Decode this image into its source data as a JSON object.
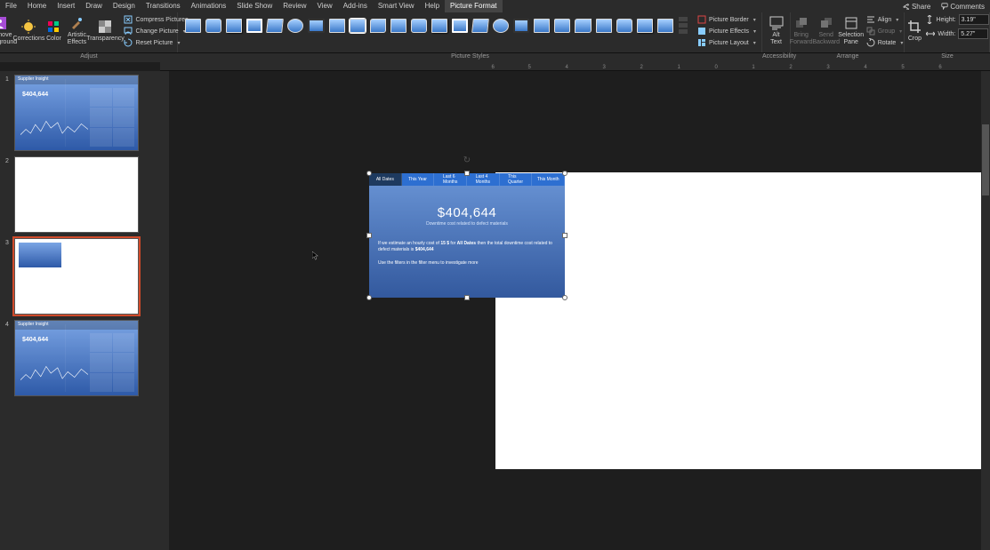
{
  "menu": {
    "tabs": [
      "File",
      "Home",
      "Insert",
      "Draw",
      "Design",
      "Transitions",
      "Animations",
      "Slide Show",
      "Review",
      "View",
      "Add-ins",
      "Smart View",
      "Help",
      "Picture Format"
    ],
    "active_index": 13,
    "share": "Share",
    "comments": "Comments"
  },
  "ribbon": {
    "adjust": {
      "remove_bg": "Remove\nBackground",
      "corrections": "Corrections",
      "color": "Color",
      "artistic": "Artistic\nEffects",
      "transparency": "Transparency",
      "compress": "Compress Pictures",
      "change": "Change Picture",
      "reset": "Reset Picture",
      "label": "Adjust"
    },
    "styles_label": "Picture Styles",
    "picture_border": "Picture Border",
    "picture_effects": "Picture Effects",
    "picture_layout": "Picture Layout",
    "accessibility": {
      "alt_text": "Alt\nText",
      "label": "Accessibility"
    },
    "arrange": {
      "bring_forward": "Bring\nForward",
      "send_backward": "Send\nBackward",
      "selection_pane": "Selection\nPane",
      "align": "Align",
      "group": "Group",
      "rotate": "Rotate",
      "label": "Arrange"
    },
    "size": {
      "crop": "Crop",
      "height_label": "Height:",
      "height_value": "3.19\"",
      "width_label": "Width:",
      "width_value": "5.27\"",
      "label": "Size"
    }
  },
  "ruler": {
    "marks": [
      "6",
      "5",
      "4",
      "3",
      "2",
      "1",
      "0",
      "1",
      "2",
      "3",
      "4",
      "5",
      "6"
    ]
  },
  "slides": [
    {
      "num": "1",
      "type": "dashboard",
      "title": "Supplier Insight",
      "big": "$404,644"
    },
    {
      "num": "2",
      "type": "blank"
    },
    {
      "num": "3",
      "type": "card",
      "selected": true
    },
    {
      "num": "4",
      "type": "dashboard",
      "title": "Supplier Insight",
      "big": "$404,644"
    }
  ],
  "picture": {
    "tabs": [
      "All Dates",
      "This Year",
      "Last 6\nMonths",
      "Last 4\nMonths",
      "This\nQuarter",
      "This Month"
    ],
    "active_tab": 0,
    "bignum": "$404,644",
    "subtitle": "Downtime cost related to defect materials",
    "estimate_prefix": "If we estimate an hourly cost of ",
    "estimate_rate": "15 $",
    "estimate_mid": " for ",
    "estimate_range": "All Dates",
    "estimate_suffix": " then the total downtime cost related to defect materials is ",
    "estimate_total": "$404,644",
    "hint": "Use the filters in the filter menu to investigate more"
  }
}
